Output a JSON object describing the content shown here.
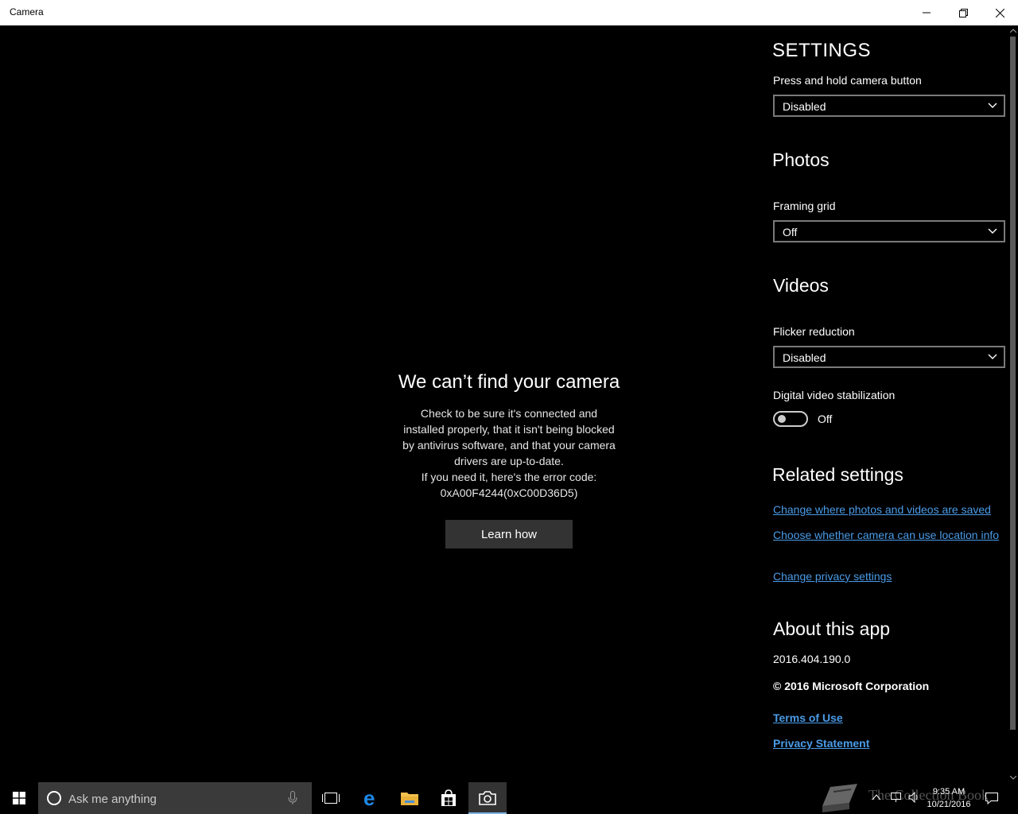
{
  "window": {
    "title": "Camera"
  },
  "error": {
    "title": "We can’t find your camera",
    "lines": [
      "Check to be sure it's connected and",
      "installed properly, that it isn't being blocked",
      "by antivirus software, and that your camera",
      "drivers are up-to-date.",
      "If you need it, here's the error code:",
      "0xA00F4244(0xC00D36D5)"
    ],
    "button": "Learn how"
  },
  "settings": {
    "header": "SETTINGS",
    "camera_button": {
      "label": "Press and hold camera button",
      "value": "Disabled"
    },
    "photos": {
      "header": "Photos",
      "framing_grid": {
        "label": "Framing grid",
        "value": "Off"
      }
    },
    "videos": {
      "header": "Videos",
      "flicker": {
        "label": "Flicker reduction",
        "value": "Disabled"
      },
      "stabilization": {
        "label": "Digital video stabilization",
        "state": "Off"
      }
    },
    "related": {
      "header": "Related settings",
      "links": [
        "Change where photos and videos are saved",
        "Choose whether camera can use location info",
        "Change privacy settings"
      ]
    },
    "about": {
      "header": "About this app",
      "version": "2016.404.190.0",
      "copyright": "© 2016 Microsoft Corporation",
      "terms": "Terms of Use",
      "privacy": "Privacy Statement"
    }
  },
  "taskbar": {
    "search_placeholder": "Ask me anything",
    "watermark": "The Collection Book",
    "time": "9:35 AM",
    "date": "10/21/2016"
  },
  "colors": {
    "link": "#4a9be8",
    "accent": "#0078d7",
    "button_bg": "#333333"
  }
}
